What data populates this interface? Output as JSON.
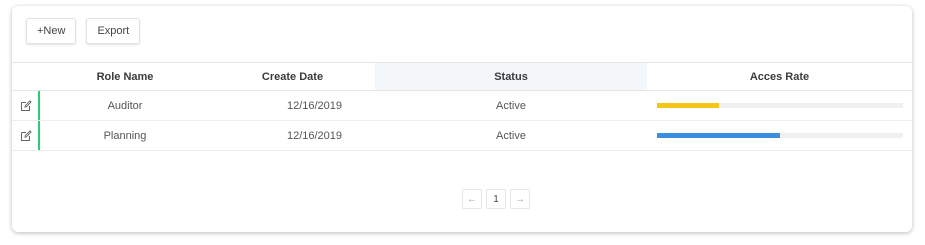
{
  "toolbar": {
    "new_label": "+New",
    "export_label": "Export"
  },
  "table": {
    "columns": [
      "Role Name",
      "Create Date",
      "Status",
      "Acces Rate"
    ],
    "rows": [
      {
        "role": "Auditor",
        "date": "12/16/2019",
        "status": "Active",
        "rate": 0.25,
        "rate_color": "#f5c518"
      },
      {
        "role": "Planning",
        "date": "12/16/2019",
        "status": "Active",
        "rate": 0.5,
        "rate_color": "#3a8fe0"
      }
    ]
  },
  "pagination": {
    "prev": "←",
    "page": "1",
    "next": "→"
  },
  "colors": {
    "row_accent": "#2ecc71",
    "header_highlight": "#f3f7fa"
  },
  "icons": {
    "row_action": "edit-icon"
  }
}
